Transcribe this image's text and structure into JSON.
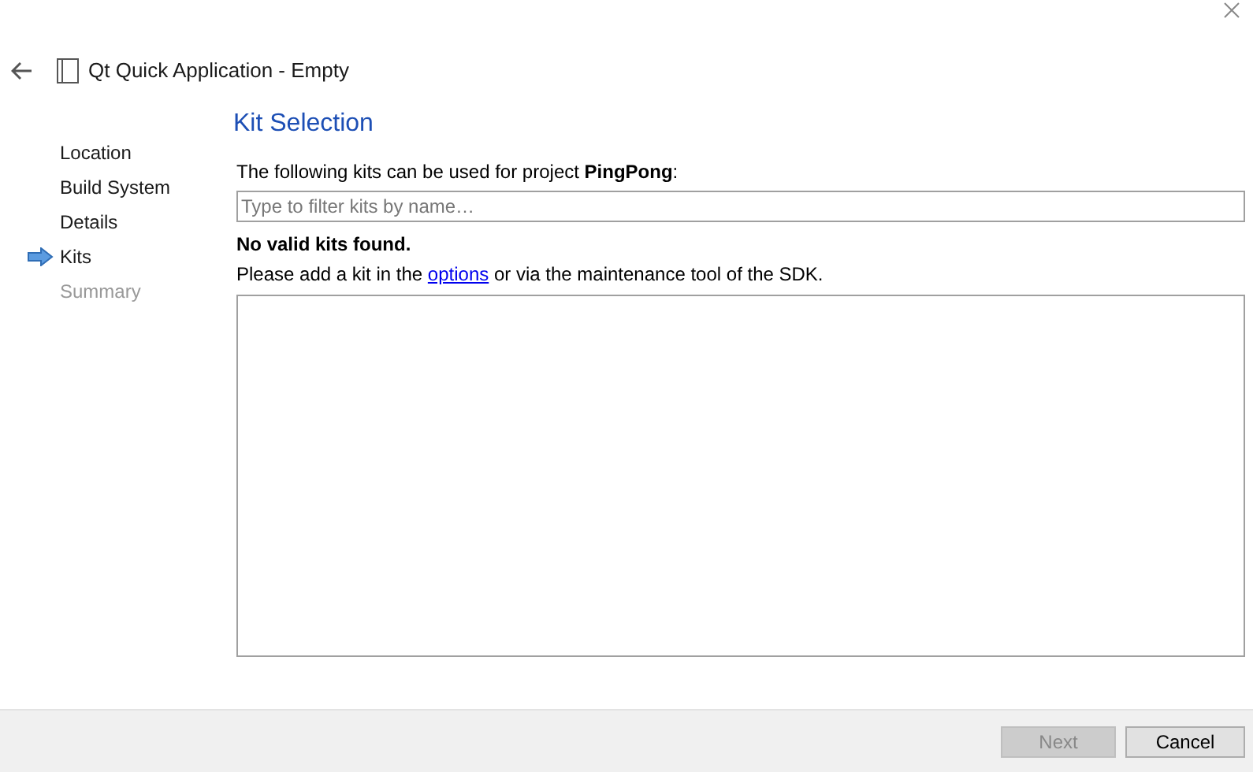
{
  "window": {
    "title": "Qt Quick Application - Empty"
  },
  "steps": [
    {
      "label": "Location",
      "selected": false,
      "disabled": false
    },
    {
      "label": "Build System",
      "selected": false,
      "disabled": false
    },
    {
      "label": "Details",
      "selected": false,
      "disabled": false
    },
    {
      "label": "Kits",
      "selected": true,
      "disabled": false
    },
    {
      "label": "Summary",
      "selected": false,
      "disabled": true
    }
  ],
  "page": {
    "heading": "Kit Selection",
    "intro": "The following kits can be used for project **PingPong**:",
    "filter": {
      "placeholder": "Type to filter kits by name…"
    },
    "warning": "No valid kits found.",
    "hint": {
      "before": "Please add a kit in the",
      "link": "options",
      "after": "or via the maintenance tool of the SDK."
    }
  },
  "buttons": [
    {
      "label": "Next",
      "disabled": true
    },
    {
      "label": "Cancel",
      "disabled": false
    }
  ]
}
